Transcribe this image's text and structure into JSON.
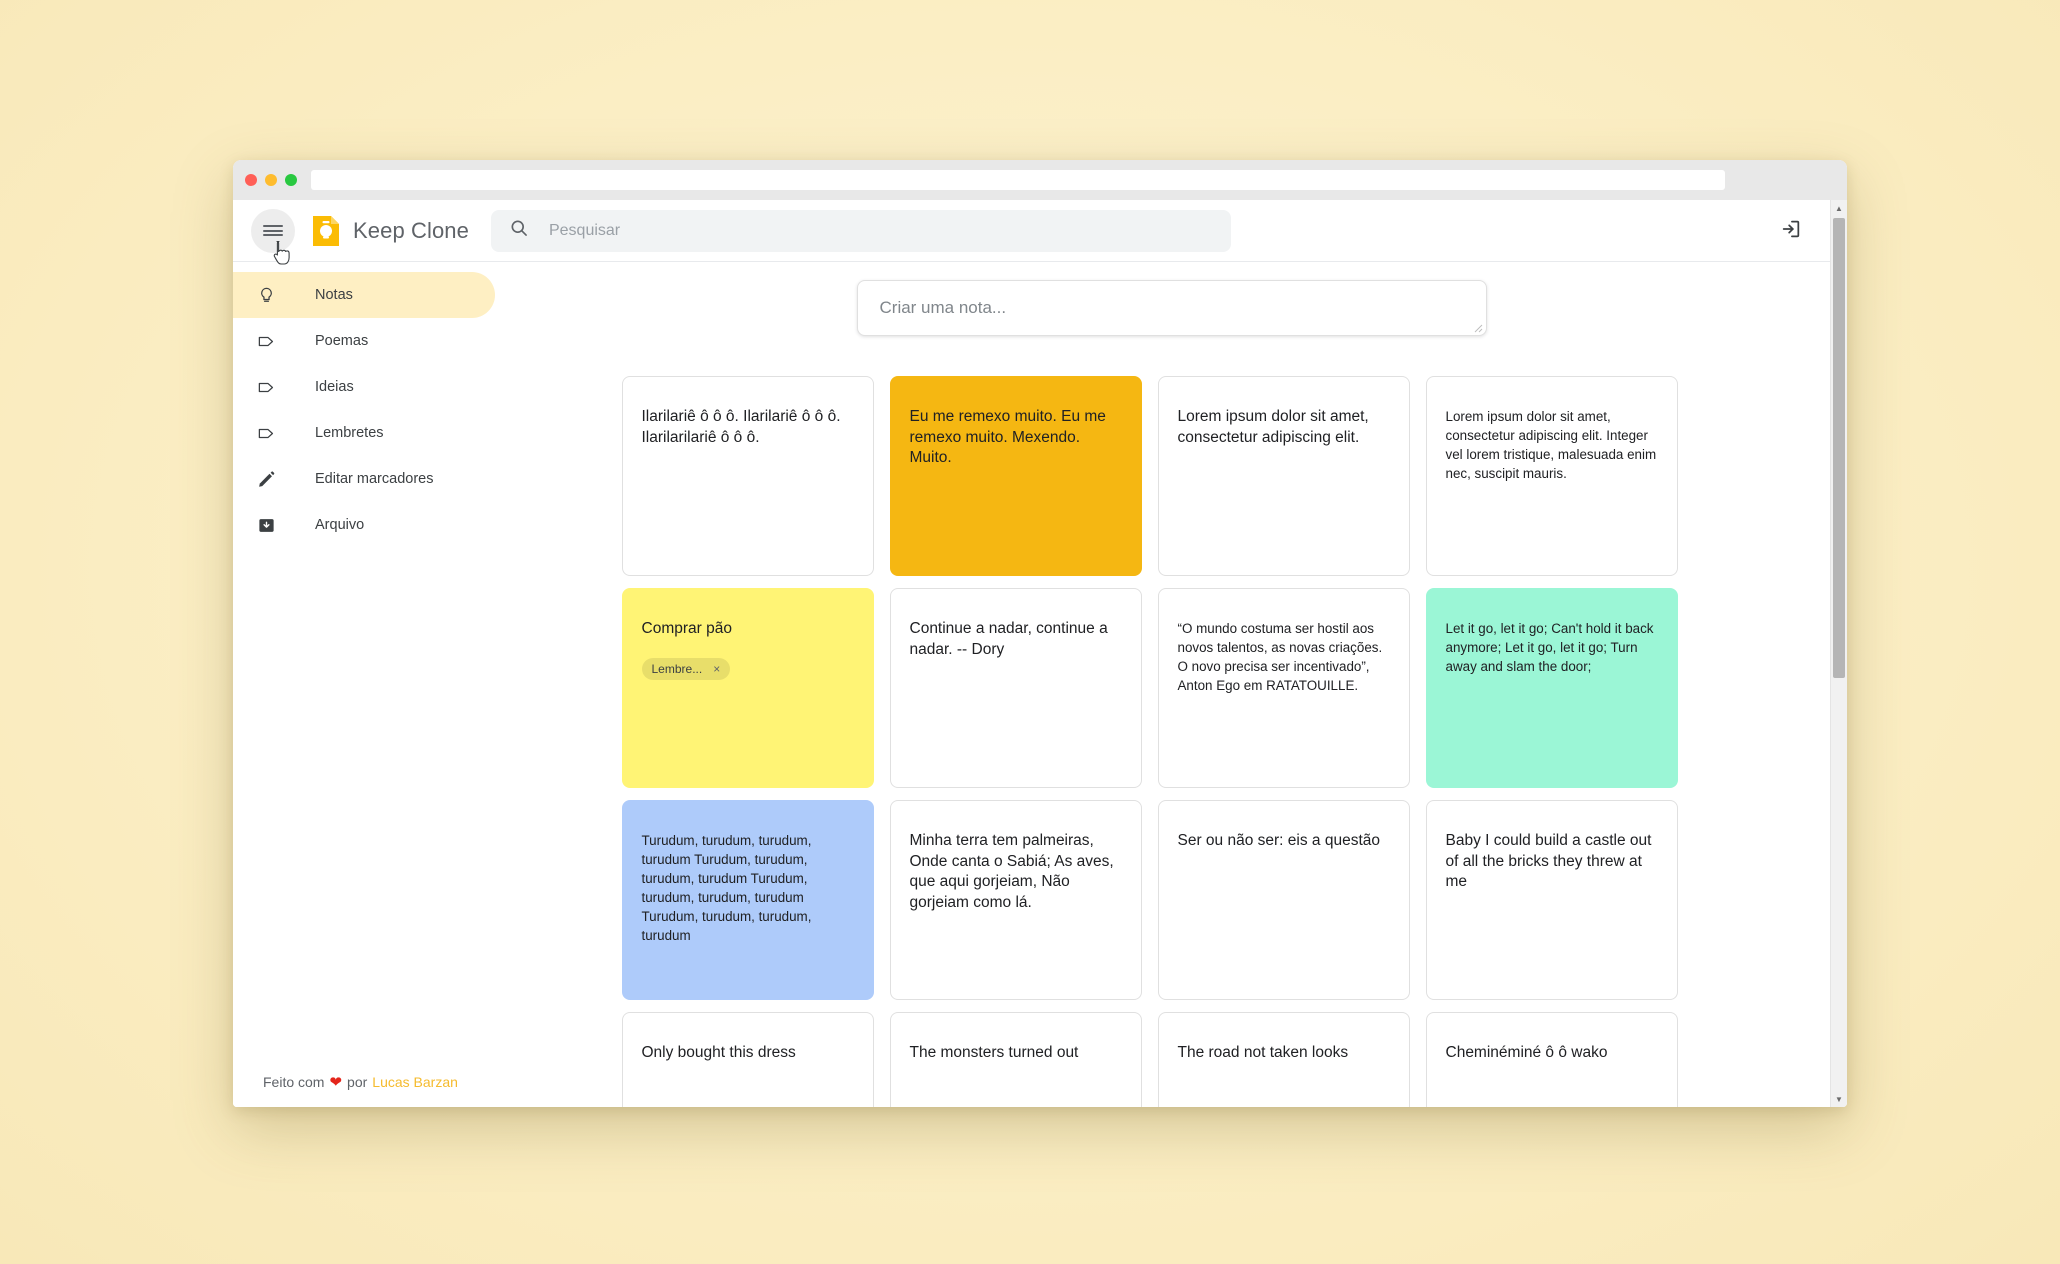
{
  "window": {
    "traffic_lights": [
      "close",
      "minimize",
      "maximize"
    ],
    "url_value": ""
  },
  "header": {
    "menu_icon": "hamburger-menu-icon",
    "logo_icon": "keep-logo-icon",
    "title": "Keep Clone",
    "search": {
      "icon": "search-icon",
      "placeholder": "Pesquisar",
      "value": ""
    },
    "logout_icon": "logout-icon"
  },
  "sidebar": {
    "items": [
      {
        "label": "Notas",
        "icon": "lightbulb-icon",
        "active": true
      },
      {
        "label": "Poemas",
        "icon": "label-tag-icon",
        "active": false
      },
      {
        "label": "Ideias",
        "icon": "label-tag-icon",
        "active": false
      },
      {
        "label": "Lembretes",
        "icon": "label-tag-icon",
        "active": false
      },
      {
        "label": "Editar marcadores",
        "icon": "pencil-icon",
        "active": false
      },
      {
        "label": "Arquivo",
        "icon": "archive-icon",
        "active": false
      }
    ],
    "footer": {
      "prefix": "Feito com",
      "heart": "❤",
      "middle": "por",
      "author": "Lucas Barzan",
      "author_color": "#f5bb2e"
    }
  },
  "create_note": {
    "placeholder": "Criar uma nota...",
    "value": "",
    "resize_handle_icon": "resize-handle-icon"
  },
  "notes": [
    {
      "text": "Ilarilariê ô ô ô. Ilarilariê ô ô ô. Ilarilarilariê ô ô ô.",
      "color": "#ffffff",
      "small": false,
      "tags": []
    },
    {
      "text": "Eu me remexo muito. Eu me remexo muito. Mexendo. Muito.",
      "color": "#f5b712",
      "small": false,
      "tags": []
    },
    {
      "text": "Lorem ipsum dolor sit amet, consectetur adipiscing elit.",
      "color": "#ffffff",
      "small": false,
      "tags": []
    },
    {
      "text": "Lorem ipsum dolor sit amet, consectetur adipiscing elit. Integer vel lorem tristique, malesuada enim nec, suscipit mauris.",
      "color": "#ffffff",
      "small": true,
      "tags": []
    },
    {
      "text": "Comprar pão",
      "color": "#fff475",
      "small": false,
      "tags": [
        {
          "label": "Lembre...",
          "remove_icon": "close-icon"
        }
      ]
    },
    {
      "text": "Continue a nadar, continue a nadar. -- Dory",
      "color": "#ffffff",
      "small": false,
      "tags": []
    },
    {
      "text": "“O mundo costuma ser hostil aos novos talentos, as novas criações. O novo precisa ser incentivado”, Anton Ego em RATATOUILLE.",
      "color": "#ffffff",
      "small": true,
      "tags": []
    },
    {
      "text": "Let it go, let it go; Can't hold it back anymore; Let it go, let it go; Turn away and slam the door;",
      "color": "#9bf6d6",
      "small": true,
      "tags": []
    },
    {
      "text": "Turudum, turudum, turudum, turudum Turudum, turudum, turudum, turudum Turudum, turudum, turudum, turudum Turudum, turudum, turudum, turudum",
      "color": "#aecbfa",
      "small": true,
      "tags": []
    },
    {
      "text": "Minha terra tem palmeiras, Onde canta o Sabiá; As aves, que aqui gorjeiam, Não gorjeiam como lá.",
      "color": "#ffffff",
      "small": false,
      "tags": []
    },
    {
      "text": "Ser ou não ser: eis a questão",
      "color": "#ffffff",
      "small": false,
      "tags": []
    },
    {
      "text": "Baby I could build a castle out of all the bricks they threw at me",
      "color": "#ffffff",
      "small": false,
      "tags": []
    },
    {
      "text": "Only bought this dress",
      "color": "#ffffff",
      "small": false,
      "tags": []
    },
    {
      "text": "The monsters turned out",
      "color": "#ffffff",
      "small": false,
      "tags": []
    },
    {
      "text": "The road not taken looks",
      "color": "#ffffff",
      "small": false,
      "tags": []
    },
    {
      "text": "Cheminéminé ô ô wako",
      "color": "#ffffff",
      "small": false,
      "tags": []
    }
  ],
  "scrollbar": {
    "up_arrow_icon": "triangle-up-icon",
    "down_arrow_icon": "triangle-down-icon"
  }
}
